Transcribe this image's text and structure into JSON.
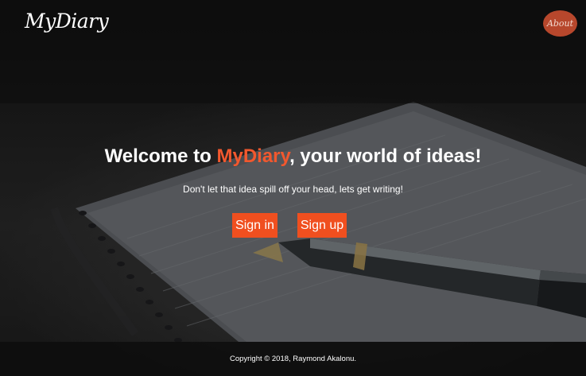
{
  "header": {
    "brand": "MyDiary",
    "about_label": "About"
  },
  "hero": {
    "headline_prefix": "Welcome to ",
    "headline_accent": "MyDiary",
    "headline_suffix": ", your world of ideas!",
    "tagline": "Don't let that idea spill off your head, lets get writing!"
  },
  "actions": {
    "signin_label": "Sign in",
    "signup_label": "Sign up"
  },
  "footer": {
    "copyright": "Copyright © 2018, Raymond Akalonu."
  },
  "colors": {
    "accent": "#f2582e",
    "button": "#f04f1f",
    "about_button": "#b7472c"
  }
}
